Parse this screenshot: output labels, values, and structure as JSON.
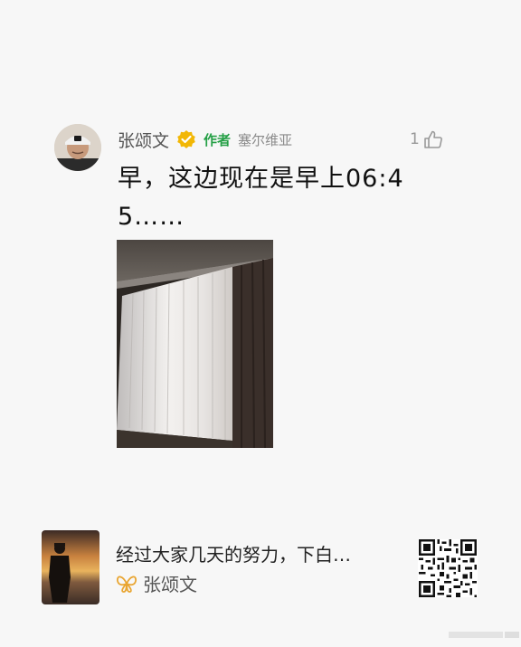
{
  "comment": {
    "author_name": "张颂文",
    "verified_icon": "verified-badge-icon",
    "author_tag": "作者",
    "location": "塞尔维亚",
    "like_count": "1",
    "like_icon": "thumbs-up-icon",
    "text": "早，这边现在是早上06:45……",
    "photo": "window-curtains-photo"
  },
  "footer": {
    "text": "经过大家几天的努力，下白…",
    "source_icon": "weibo-butterfly-icon",
    "source_name": "张颂文",
    "qr_code": "qr-code"
  },
  "colors": {
    "background": "#f7f7f7",
    "author_tag": "#25a046",
    "verified": "#f2b705",
    "weibo_icon": "#e9a531"
  }
}
